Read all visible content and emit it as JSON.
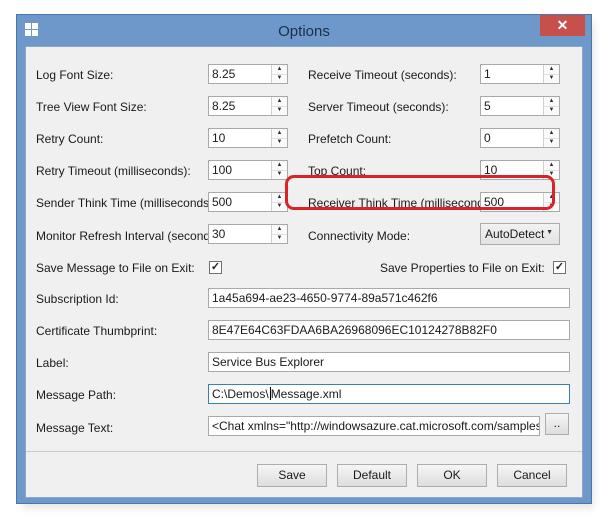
{
  "window": {
    "title": "Options",
    "close_glyph": "✕"
  },
  "left_fields": [
    {
      "label": "Log Font Size:",
      "value": "8.25"
    },
    {
      "label": "Tree View Font Size:",
      "value": "8.25"
    },
    {
      "label": "Retry Count:",
      "value": "10"
    },
    {
      "label": "Retry Timeout (milliseconds):",
      "value": "100"
    },
    {
      "label": "Sender Think Time (milliseconds):",
      "value": "500"
    },
    {
      "label": "Monitor Refresh Interval (seconds):",
      "value": "30"
    }
  ],
  "right_fields": [
    {
      "label": "Receive Timeout (seconds):",
      "value": "1"
    },
    {
      "label": "Server Timeout (seconds):",
      "value": "5"
    },
    {
      "label": "Prefetch Count:",
      "value": "0"
    },
    {
      "label": "Top Count:",
      "value": "10"
    },
    {
      "label": "Receiver Think Time (milliseconds):",
      "value": "500"
    }
  ],
  "connectivity": {
    "label": "Connectivity Mode:",
    "value": "AutoDetect"
  },
  "checkboxes": {
    "save_message": {
      "label": "Save Message to File on Exit:",
      "checked": true,
      "glyph": "✓"
    },
    "save_properties": {
      "label": "Save Properties to File on Exit:",
      "checked": true,
      "glyph": "✓"
    }
  },
  "text_fields": [
    {
      "label": "Subscription Id:",
      "value": "1a45a694-ae23-4650-9774-89a571c462f6"
    },
    {
      "label": "Certificate Thumbprint:",
      "value": "8E47E64C63FDAA6BA26968096EC10124278B82F0"
    },
    {
      "label": "Label:",
      "value": "Service Bus Explorer"
    }
  ],
  "message_path": {
    "label": "Message Path:",
    "value_before_caret": "C:\\Demos\\",
    "value_after_caret": "Message.xml"
  },
  "message_text": {
    "label": "Message Text:",
    "value": "<Chat xmlns=\"http://windowsazure.cat.microsoft.com/samples/multic",
    "browse_label": ".."
  },
  "buttons": {
    "save": "Save",
    "default": "Default",
    "ok": "OK",
    "cancel": "Cancel"
  },
  "icons": {
    "spin_up": "▲",
    "spin_down": "▼",
    "combo_arrow": "▼",
    "app": "windows-logo-icon"
  },
  "colors": {
    "frame": "#6d98c9",
    "close": "#c7504a",
    "highlight": "#d8232a"
  }
}
